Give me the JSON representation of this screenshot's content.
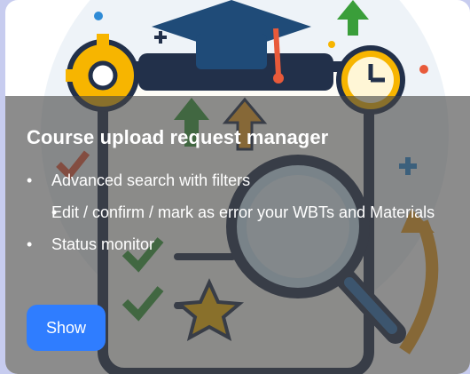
{
  "card": {
    "title": "Course upload request manager",
    "features": [
      "Advanced search with filters",
      "Edit / confirm / mark as error your WBTs and Materials",
      "Status monitor"
    ],
    "show_button": "Show"
  },
  "illustration": {
    "icons": [
      "graduation-cap-icon",
      "gear-icon",
      "clock-icon",
      "magnifying-glass-icon",
      "checklist-icon",
      "star-icon",
      "arrow-up-icon",
      "plus-icon"
    ]
  },
  "colors": {
    "button": "#2f7dff",
    "overlay": "#464646",
    "accent_yellow": "#f7b500",
    "accent_green": "#3a9e3a",
    "accent_navy": "#22304a"
  }
}
